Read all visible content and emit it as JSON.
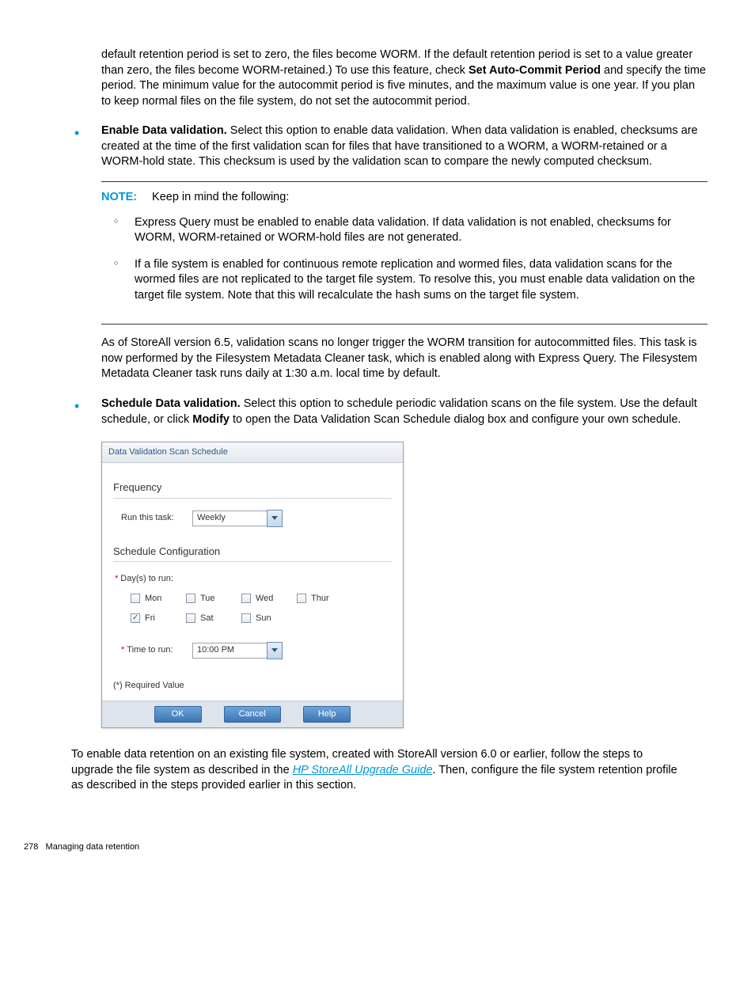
{
  "para_continued": "default retention period is set to zero, the files become WORM. If the default retention period is set to a value greater than zero, the files become WORM-retained.) To use this feature, check ",
  "para_continued_bold": "Set Auto-Commit Period",
  "para_continued_tail": " and specify the time period. The minimum value for the autocommit period is five minutes, and the maximum value is one year. If you plan to keep normal files on the file system, do not set the autocommit period.",
  "bullets": {
    "enable": {
      "head": "Enable Data validation.",
      "body": " Select this option to enable data validation. When data validation is enabled, checksums are created at the time of the first validation scan for files that have transitioned to a WORM, a WORM-retained or a WORM-hold state. This checksum is used by the validation scan to compare the newly computed checksum."
    },
    "schedule": {
      "head": "Schedule Data validation.",
      "body_a": " Select this option to schedule periodic validation scans on the file system. Use the default schedule, or click ",
      "body_bold": "Modify",
      "body_b": " to open the Data Validation Scan Schedule dialog box and configure your own schedule."
    }
  },
  "note": {
    "label": "NOTE:",
    "intro": "Keep in mind the following:",
    "items": [
      "Express Query must be enabled to enable data validation. If data validation is not enabled, checksums for WORM, WORM-retained or WORM-hold files are not generated.",
      "If a file system is enabled for continuous remote replication and wormed files, data validation scans for the wormed files are not replicated to the target file system. To resolve this, you must enable data validation on the target file system. Note that this will recalculate the hash sums on the target file system."
    ]
  },
  "after_note": "As of StoreAll version 6.5, validation scans no longer trigger the WORM transition for autocommitted files. This task is now performed by the Filesystem Metadata Cleaner task, which is enabled along with Express Query. The Filesystem Metadata Cleaner task runs daily at 1:30 a.m. local time by default.",
  "dialog": {
    "title": "Data Validation Scan Schedule",
    "sections": {
      "frequency": "Frequency",
      "schedule_cfg": "Schedule Configuration"
    },
    "run_label": "Run this task:",
    "run_value": "Weekly",
    "days_label": "Day(s) to run:",
    "days": [
      {
        "label": "Mon",
        "checked": false
      },
      {
        "label": "Tue",
        "checked": false
      },
      {
        "label": "Wed",
        "checked": false
      },
      {
        "label": "Thur",
        "checked": false
      },
      {
        "label": "Fri",
        "checked": true
      },
      {
        "label": "Sat",
        "checked": false
      },
      {
        "label": "Sun",
        "checked": false
      }
    ],
    "time_label": "Time to run:",
    "time_value": "10:00 PM",
    "req_note": "(*) Required Value",
    "buttons": {
      "ok": "OK",
      "cancel": "Cancel",
      "help": "Help"
    }
  },
  "closing": {
    "a": "To enable data retention on an existing file system, created with StoreAll version 6.0 or earlier, follow the steps to upgrade the file system as described in the ",
    "link": "HP StoreAll Upgrade Guide",
    "b": ". Then, configure the file system retention profile as described in the steps provided earlier in this section."
  },
  "footer": {
    "page": "278",
    "title": "Managing data retention"
  }
}
